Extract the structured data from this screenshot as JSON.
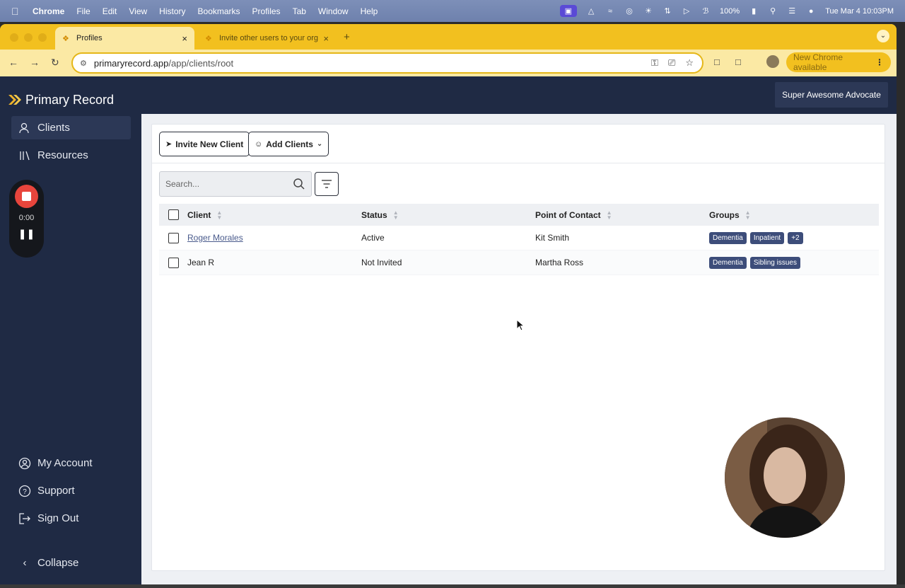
{
  "menubar": {
    "app_name": "Chrome",
    "items": [
      "File",
      "Edit",
      "View",
      "History",
      "Bookmarks",
      "Profiles",
      "Tab",
      "Window",
      "Help"
    ],
    "battery": "100%",
    "datetime": "Tue Mar 4  10:03PM"
  },
  "browser": {
    "tabs": [
      {
        "title": "Profiles",
        "active": true
      },
      {
        "title": "Invite other users to your org",
        "active": false
      }
    ],
    "url_host": "primaryrecord.app",
    "url_path": "/app/clients/root",
    "update_label": "New Chrome available"
  },
  "app": {
    "brand": "Primary Record",
    "user_label": "Super Awesome Advocate",
    "nav_top": [
      {
        "label": "Clients",
        "icon": "users-icon",
        "selected": true
      },
      {
        "label": "Resources",
        "icon": "library-icon",
        "selected": false
      }
    ],
    "nav_bottom": [
      {
        "label": "My Account",
        "icon": "account-icon"
      },
      {
        "label": "Support",
        "icon": "help-icon"
      },
      {
        "label": "Sign Out",
        "icon": "sign-out-icon"
      }
    ],
    "collapse_label": "Collapse",
    "recorder_time": "0:00"
  },
  "clients_page": {
    "invite_button": "Invite New Client",
    "add_button": "Add Clients",
    "search_placeholder": "Search...",
    "columns": [
      "Client",
      "Status",
      "Point of Contact",
      "Groups"
    ],
    "rows": [
      {
        "client": "Roger Morales",
        "status": "Active",
        "contact": "Kit Smith",
        "groups": [
          "Dementia",
          "Inpatient",
          "+2"
        ],
        "is_link": true
      },
      {
        "client": "Jean R",
        "status": "Not Invited",
        "contact": "Martha Ross",
        "groups": [
          "Dementia",
          "Sibling issues"
        ],
        "is_link": false
      }
    ]
  },
  "colors": {
    "sidebar": "#1f2a44",
    "chrome_theme": "#f2c01f",
    "tag": "#3d4d7a",
    "record": "#e8453c"
  }
}
